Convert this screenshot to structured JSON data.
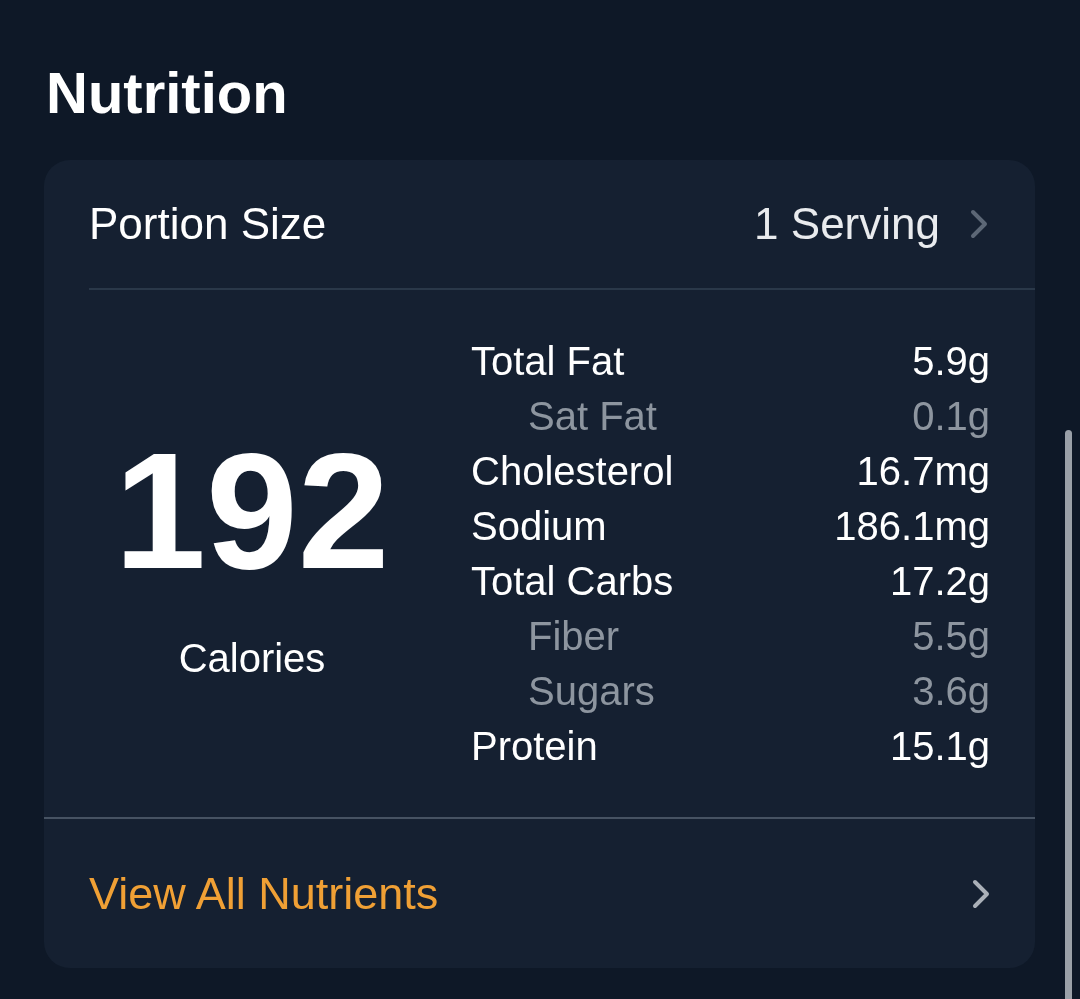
{
  "title": "Nutrition",
  "portion": {
    "label": "Portion Size",
    "value": "1 Serving"
  },
  "calories": {
    "value": "192",
    "label": "Calories"
  },
  "nutrients": [
    {
      "name": "Total Fat",
      "amount": "5.9g",
      "kind": "main"
    },
    {
      "name": "Sat Fat",
      "amount": "0.1g",
      "kind": "sub"
    },
    {
      "name": "Cholesterol",
      "amount": "16.7mg",
      "kind": "main"
    },
    {
      "name": "Sodium",
      "amount": "186.1mg",
      "kind": "main"
    },
    {
      "name": "Total Carbs",
      "amount": "17.2g",
      "kind": "main"
    },
    {
      "name": "Fiber",
      "amount": "5.5g",
      "kind": "sub"
    },
    {
      "name": "Sugars",
      "amount": "3.6g",
      "kind": "sub"
    },
    {
      "name": "Protein",
      "amount": "15.1g",
      "kind": "main"
    }
  ],
  "link": {
    "label": "View All Nutrients"
  }
}
